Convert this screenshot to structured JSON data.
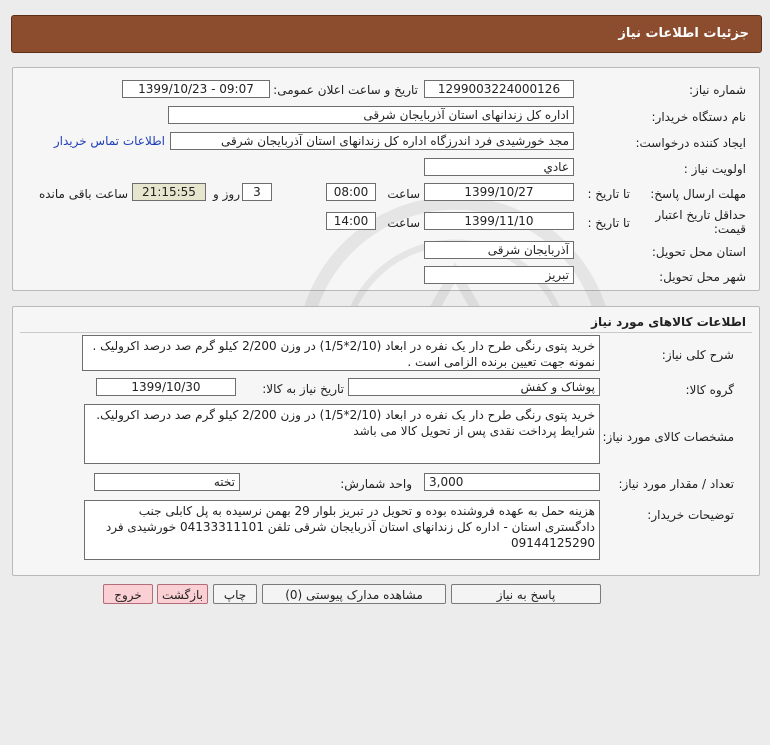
{
  "header": {
    "title": "جزئیات اطلاعات نیاز"
  },
  "info": {
    "need_number_label": "شماره نیاز:",
    "need_number": "1299003224000126",
    "announce_label": "تاریخ و ساعت اعلان عمومی:",
    "announce_value": "1399/10/23 - 09:07",
    "buyer_org_label": "نام دستگاه خریدار:",
    "buyer_org": "اداره کل زندانهای استان آذربایجان شرقی",
    "creator_label": "ایجاد کننده درخواست:",
    "creator": "مجد خورشیدی فرد اندرزگاه اداره کل زندانهای استان آذربایجان شرقی",
    "contact_link": "اطلاعات تماس خریدار",
    "priority_label": "اولویت نیاز :",
    "priority": "عادي",
    "deadline_label": "مهلت ارسال پاسخ:",
    "to_date_label": "تا تاریخ :",
    "deadline_date": "1399/10/27",
    "time_label": "ساعت",
    "deadline_time": "08:00",
    "days": "3",
    "days_label": "روز و",
    "remaining_time": "21:15:55",
    "remaining_label": "ساعت باقی مانده",
    "price_validity_label": "حداقل تاریخ اعتبار قیمت:",
    "price_to_date_label": "تا تاریخ :",
    "price_date": "1399/11/10",
    "price_time_label": "ساعت",
    "price_time": "14:00",
    "province_label": "استان محل تحویل:",
    "province": "آذربایجان شرقی",
    "city_label": "شهر محل تحویل:",
    "city": "تبریز"
  },
  "goods": {
    "title": "اطلاعات کالاهای مورد نیاز",
    "desc_label": "شرح کلی نیاز:",
    "desc": "خرید پتوی رنگی طرح دار یک نفره در ابعاد (2/10*1/5) در وزن 2/200 کیلو گرم صد درصد اکرولیک .\nنمونه جهت تعیین برنده الزامی است .",
    "group_label": "گروه کالا:",
    "group": "پوشاک و کفش",
    "need_date_label": "تاریخ نیاز به کالا:",
    "need_date": "1399/10/30",
    "spec_label": "مشخصات کالای مورد نیاز:",
    "spec": "خرید پتوی رنگی طرح دار یک نفره در ابعاد (2/10*1/5) در وزن 2/200 کیلو گرم صد درصد اکرولیک.\nشرایط پرداخت نقدی پس از تحویل کالا می باشد",
    "qty_label": "تعداد / مقدار مورد نیاز:",
    "qty": "3,000",
    "unit_label": "واحد شمارش:",
    "unit": "تخته",
    "buyer_notes_label": "توضیحات خریدار:",
    "buyer_notes": "هزینه حمل به عهده فروشنده بوده و تحویل در تبریز بلوار 29 بهمن نرسیده به پل کابلی جنب دادگستری استان - اداره کل زندانهای استان آذربایجان شرقی تلفن 04133311101 خورشیدی فرد 09144125290"
  },
  "buttons": {
    "reply": "پاسخ به نیاز",
    "attachments": "مشاهده مدارک پیوستی (0)",
    "print": "چاپ",
    "back": "بازگشت",
    "exit": "خروج"
  }
}
